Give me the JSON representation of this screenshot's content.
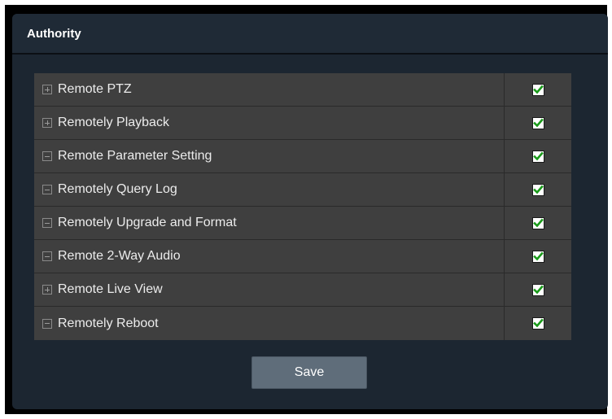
{
  "panel": {
    "title": "Authority"
  },
  "permissions": [
    {
      "label": "Remote PTZ",
      "expander": "plus",
      "checked": true
    },
    {
      "label": "Remotely Playback",
      "expander": "plus",
      "checked": true
    },
    {
      "label": "Remote Parameter Setting",
      "expander": "minus",
      "checked": true
    },
    {
      "label": "Remotely Query Log",
      "expander": "minus",
      "checked": true
    },
    {
      "label": "Remotely Upgrade and Format",
      "expander": "minus",
      "checked": true
    },
    {
      "label": "Remote 2-Way Audio",
      "expander": "minus",
      "checked": true
    },
    {
      "label": "Remote Live View",
      "expander": "plus",
      "checked": true
    },
    {
      "label": "Remotely Reboot",
      "expander": "minus",
      "checked": true
    }
  ],
  "actions": {
    "save_label": "Save"
  },
  "colors": {
    "panel_bg": "#1c2631",
    "row_bg": "#3f3f3f",
    "check_green": "#1a9a1a",
    "button_bg": "#5f6d7a"
  }
}
